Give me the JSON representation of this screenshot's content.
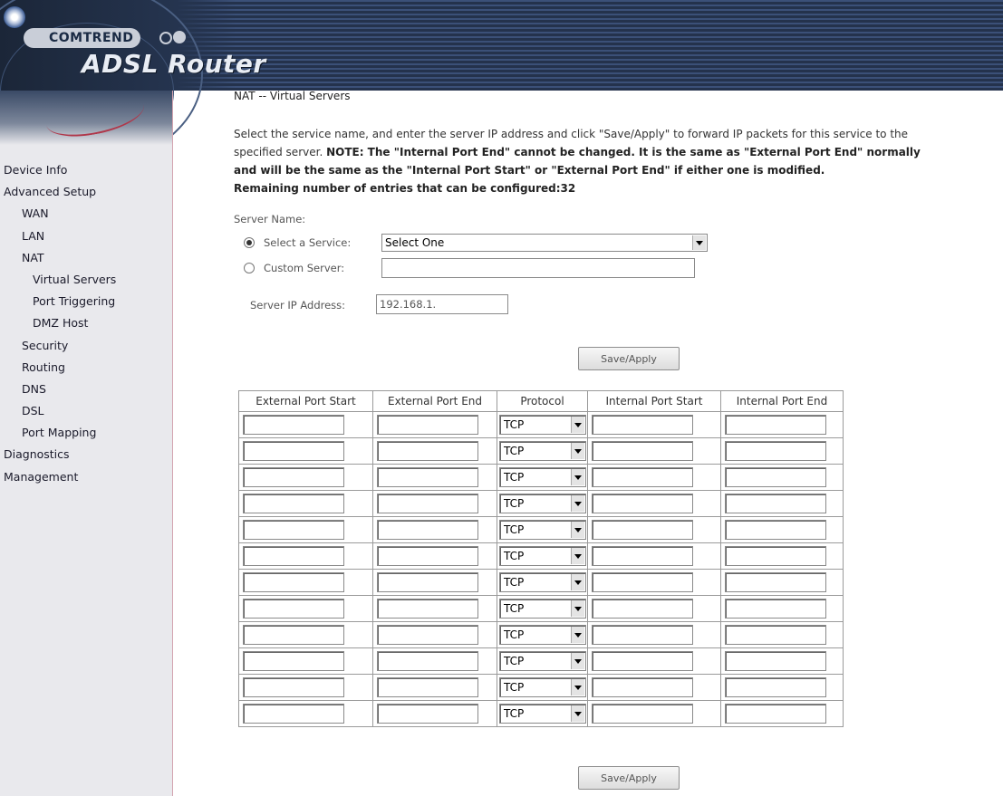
{
  "header": {
    "brand": "COMTREND",
    "product": "ADSL Router"
  },
  "nav": [
    {
      "label": "Device Info",
      "level": 0
    },
    {
      "label": "Advanced Setup",
      "level": 0
    },
    {
      "label": "WAN",
      "level": 1
    },
    {
      "label": "LAN",
      "level": 1
    },
    {
      "label": "NAT",
      "level": 1
    },
    {
      "label": "Virtual Servers",
      "level": 2
    },
    {
      "label": "Port Triggering",
      "level": 2
    },
    {
      "label": "DMZ Host",
      "level": 2
    },
    {
      "label": "Security",
      "level": 1
    },
    {
      "label": "Routing",
      "level": 1
    },
    {
      "label": "DNS",
      "level": 1
    },
    {
      "label": "DSL",
      "level": 1
    },
    {
      "label": "Port Mapping",
      "level": 1
    },
    {
      "label": "Diagnostics",
      "level": 0
    },
    {
      "label": "Management",
      "level": 0
    }
  ],
  "main": {
    "title": "NAT -- Virtual Servers",
    "intro_line1": "Select the service name, and enter the server IP address and click \"Save/Apply\" to forward IP packets for this service to the",
    "intro_line2_a": "specified server. ",
    "intro_line2_b": "NOTE: The \"Internal Port End\" cannot be changed. It is the same as \"External Port End\" normally",
    "intro_line3": "and will be the same as the \"Internal Port Start\" or \"External Port End\" if either one is modified.",
    "intro_line4": "Remaining number of entries that can be configured:32",
    "server_name_label": "Server Name:",
    "select_service_label": "Select a Service:",
    "select_service_value": "Select One",
    "custom_server_label": "Custom Server:",
    "custom_server_value": "",
    "server_ip_label": "Server IP Address:",
    "server_ip_value": "192.168.1.",
    "save_label": "Save/Apply"
  },
  "table": {
    "columns": [
      "External Port Start",
      "External Port End",
      "Protocol",
      "Internal Port Start",
      "Internal Port End"
    ],
    "rows": [
      {
        "protocol": "TCP"
      },
      {
        "protocol": "TCP"
      },
      {
        "protocol": "TCP"
      },
      {
        "protocol": "TCP"
      },
      {
        "protocol": "TCP"
      },
      {
        "protocol": "TCP"
      },
      {
        "protocol": "TCP"
      },
      {
        "protocol": "TCP"
      },
      {
        "protocol": "TCP"
      },
      {
        "protocol": "TCP"
      },
      {
        "protocol": "TCP"
      },
      {
        "protocol": "TCP"
      }
    ]
  }
}
